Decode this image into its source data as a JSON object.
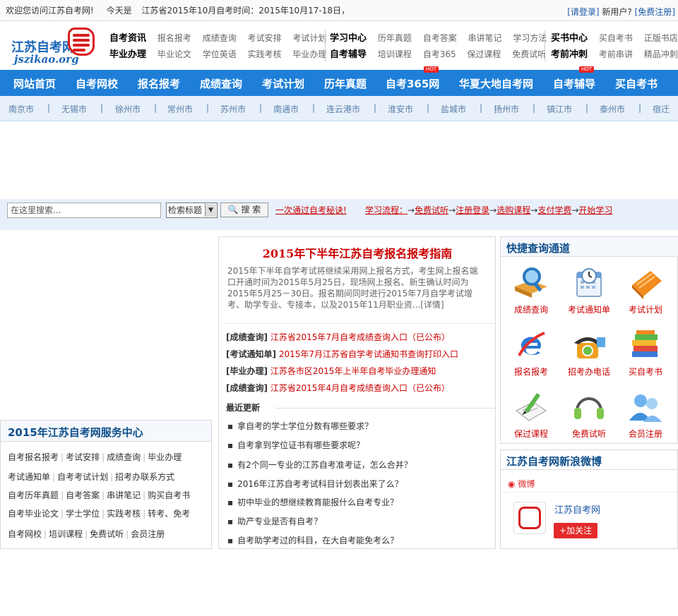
{
  "topbar": {
    "welcome": "欢迎您访问江苏自考网!",
    "today": "今天是",
    "exam_time": "江苏省2015年10月自考时间：2015年10月17-18日，",
    "login": "[请登录]",
    "new_user": "新用户?",
    "register": "[免费注册]"
  },
  "logo": {
    "title": "江苏自考网",
    "domain": "jszikao.org"
  },
  "header": {
    "g1": {
      "h1": "自考资讯",
      "l1": [
        "报名报考",
        "成绩查询",
        "考试安排",
        "考试计划"
      ],
      "h2": "毕业办理",
      "l2": [
        "毕业论文",
        "学位英语",
        "实践考核",
        "毕业办理"
      ]
    },
    "g2": {
      "h1": "学习中心",
      "l1": [
        "历年真题",
        "自考答案",
        "串讲笔记",
        "学习方法"
      ],
      "h2": "自考辅导",
      "l2": [
        "培训课程",
        "自考365",
        "保过课程",
        "免费试听"
      ]
    },
    "g3": {
      "h1": "买书中心",
      "l1": [
        "买自考书",
        "正版书店"
      ],
      "h2": "考前冲刺",
      "l2": [
        "考前串讲",
        "精品冲刺"
      ]
    }
  },
  "nav": [
    "网站首页",
    "自考网校",
    "报名报考",
    "成绩查询",
    "考试计划",
    "历年真题",
    "自考365网",
    "华夏大地自考网",
    "自考辅导",
    "买自考书"
  ],
  "hot_label": "HOT",
  "cities": [
    "南京市",
    "无锡市",
    "徐州市",
    "常州市",
    "苏州市",
    "南通市",
    "连云港市",
    "淮安市",
    "盐城市",
    "扬州市",
    "镇江市",
    "泰州市",
    "宿迁"
  ],
  "search": {
    "placeholder": "在这里搜索...",
    "select": "检索标题",
    "button": "搜 索",
    "secret": "一次通过自考秘诀!",
    "flow_label": "学习流程：",
    "steps": [
      "免费试听",
      "注册登录",
      "选购课程",
      "支付学费",
      "开始学习"
    ]
  },
  "service": {
    "title": "2015年江苏自考网服务中心",
    "rows": [
      [
        "自考报名报考",
        "考试安排",
        "成绩查询",
        "毕业办理"
      ],
      [
        "考试通知单",
        "自考考试计划",
        "招考办联系方式"
      ],
      [
        "自考历年真题",
        "自考答案",
        "串讲笔记",
        "购买自考书"
      ],
      [
        "自考毕业论文",
        "学士学位",
        "实践考核",
        "转考、免考"
      ],
      [
        "自考网校",
        "培训课程",
        "免费试听",
        "会员注册"
      ]
    ]
  },
  "guide": {
    "title": "2015年下半年江苏自考报名报考指南",
    "summary": "2015年下半年自学考试将继续采用网上报名方式，考生网上报名端口开通时间为2015年5月25日，现场网上报名、新生确认时间为2015年5月25－30日。报名期间同时进行2015年7月自学考试增考、助学专业、专接本，以及2015年11月职业资...[详情]"
  },
  "news": [
    {
      "cat": "[成绩查询]",
      "title": "江苏省2015年7月自考成绩查询入口（已公布）"
    },
    {
      "cat": "[考试通知单]",
      "title": "2015年7月江苏省自学考试通知书查询打印入口"
    },
    {
      "cat": "[毕业办理]",
      "title": "江苏各市区2015年上半年自考毕业办理通知"
    },
    {
      "cat": "[成绩查询]",
      "title": "江苏省2015年4月自考成绩查询入口（已公布）"
    }
  ],
  "recent": {
    "title": "最近更新",
    "items": [
      "拿自考的学士学位分数有哪些要求？",
      "自考拿到学位证书有哪些要求呢？",
      "有2个同一专业的江苏自考准考证，怎么合并？",
      "2016年江苏自考考试科目计划表出来了么？",
      "初中毕业的想继续教育能报什么自考专业？",
      "助产专业是否有自考？",
      "自考助学考过的科目，在大自考能免考么？"
    ]
  },
  "quick": {
    "title": "快捷查询通道",
    "items": [
      {
        "label": "成绩查询",
        "icon": "magnifier-book-icon"
      },
      {
        "label": "考试通知单",
        "icon": "calendar-clock-icon"
      },
      {
        "label": "考试计划",
        "icon": "notebook-icon"
      },
      {
        "label": "报名报考",
        "icon": "ie-logo-icon"
      },
      {
        "label": "招考办电话",
        "icon": "telephone-icon"
      },
      {
        "label": "买自考书",
        "icon": "books-icon"
      },
      {
        "label": "保过课程",
        "icon": "pencil-notepad-icon"
      },
      {
        "label": "免费试听",
        "icon": "headphones-icon"
      },
      {
        "label": "会员注册",
        "icon": "users-icon"
      }
    ]
  },
  "weibo": {
    "title": "江苏自考网新浪微博",
    "brand": "微博",
    "account": "江苏自考网",
    "follow": "+加关注"
  },
  "colors": {
    "nav_blue": "#1f7fd8",
    "title_blue": "#0e4e8a",
    "accent_red": "#cc0000",
    "city_bg": "#e7f0fb"
  }
}
